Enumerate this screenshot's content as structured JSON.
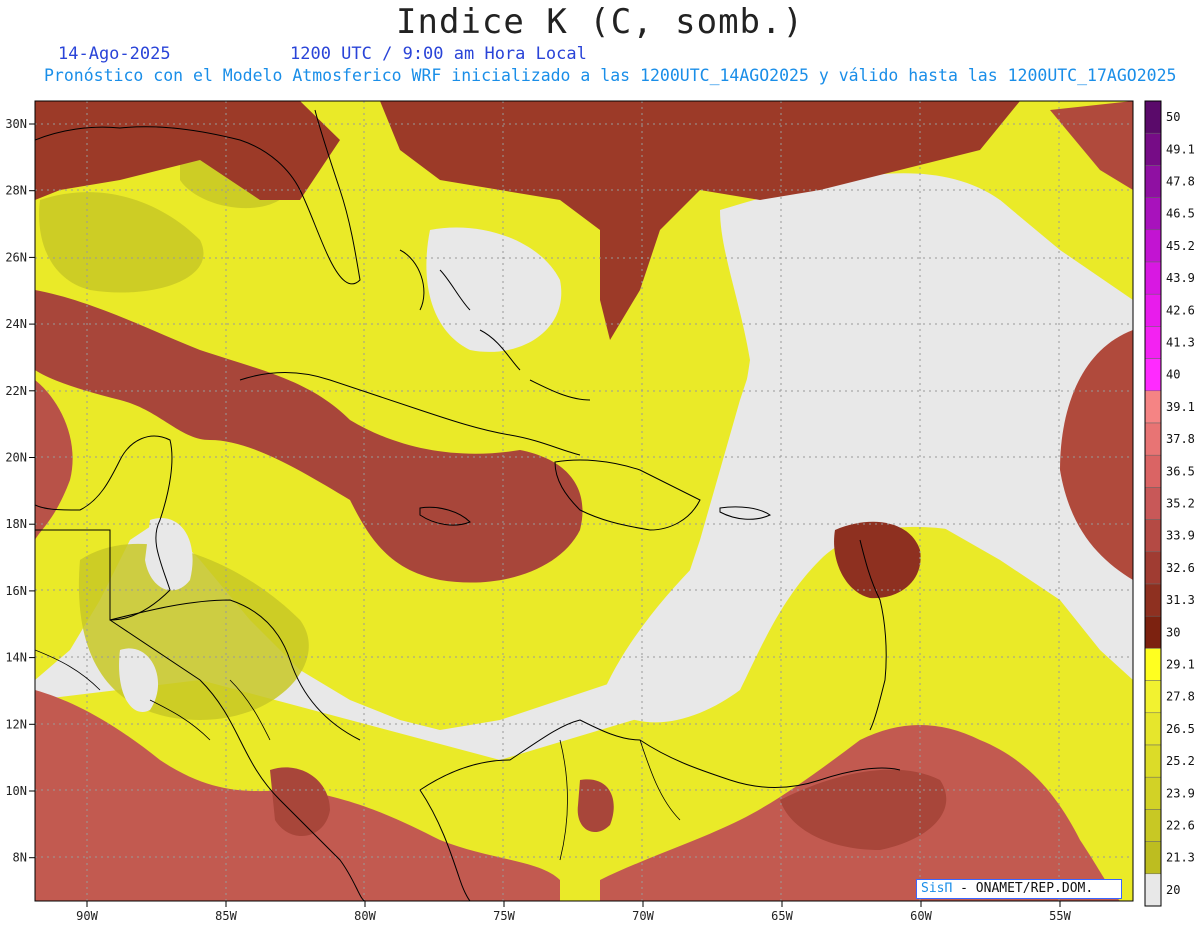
{
  "header": {
    "title": "Indice K (C, somb.)",
    "date": "14-Ago-2025",
    "time": "1200 UTC / 9:00 am Hora Local",
    "subtitle": "Pronóstico con el Modelo Atmosferico WRF inicializado a las 1200UTC_14AGO2025 y válido hasta las  1200UTC_17AGO2025"
  },
  "axes": {
    "lat_labels": [
      "30N",
      "28N",
      "26N",
      "24N",
      "22N",
      "20N",
      "18N",
      "16N",
      "14N",
      "12N",
      "10N",
      "8N"
    ],
    "lon_labels": [
      "90W",
      "85W",
      "80W",
      "75W",
      "70W",
      "65W",
      "60W",
      "55W"
    ]
  },
  "colorbar": {
    "labels": [
      "50",
      "49.1",
      "47.8",
      "46.5",
      "45.2",
      "43.9",
      "42.6",
      "41.3",
      "40",
      "39.1",
      "37.8",
      "36.5",
      "35.2",
      "33.9",
      "32.6",
      "31.3",
      "30",
      "29.1",
      "27.8",
      "26.5",
      "25.2",
      "23.9",
      "22.6",
      "21.3",
      "20"
    ],
    "colors": [
      "#5a0a6a",
      "#760c86",
      "#8f10a2",
      "#a812bc",
      "#c214d2",
      "#d818e2",
      "#e81cec",
      "#f322f2",
      "#ff2aff",
      "#f58484",
      "#e87474",
      "#da6464",
      "#c85858",
      "#b44a44",
      "#a03c32",
      "#8e3020",
      "#7c2210",
      "#ffff20",
      "#f2f230",
      "#e6e62c",
      "#dcdc28",
      "#d2d226",
      "#c8c824",
      "#bdbd20",
      "#e8e8e8"
    ]
  },
  "credit": {
    "brand": "SisΠ",
    "text": " - ONAMET/REP.DOM."
  }
}
